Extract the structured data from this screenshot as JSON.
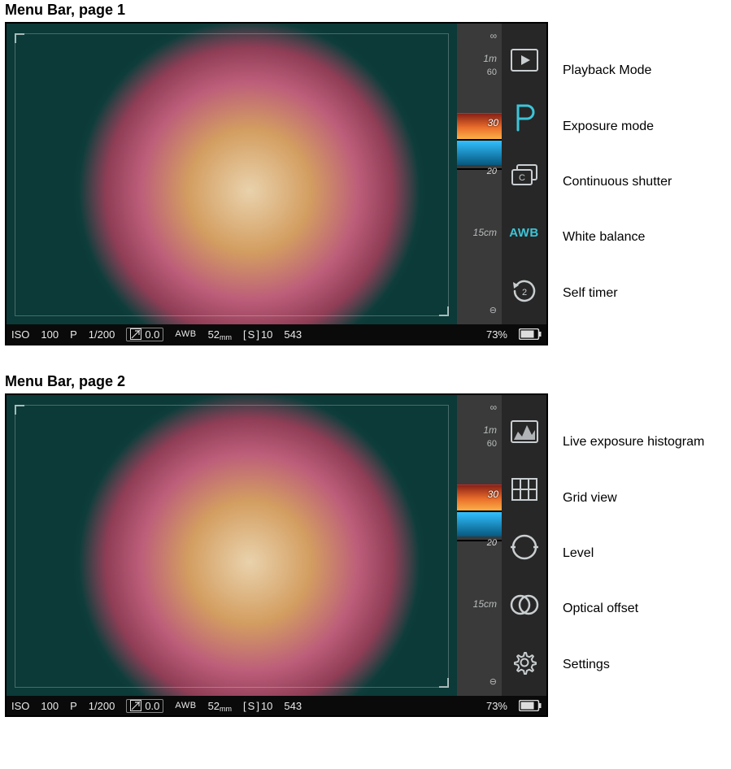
{
  "sections": [
    {
      "title": "Menu Bar, page 1"
    },
    {
      "title": "Menu Bar, page 2"
    }
  ],
  "ruler": {
    "inf": "∞",
    "d1m": "1m",
    "d60": "60",
    "d15cm": "15cm",
    "band_hi": "30",
    "band_lo": "20"
  },
  "status": {
    "iso_label": "ISO",
    "iso_value": "100",
    "mode": "P",
    "shutter": "1/200",
    "ev": "0.0",
    "awb": "AWB",
    "focal_mm": "52",
    "focal_unit": "mm",
    "bracket_s": "S",
    "bracket_n": "10",
    "shots": "543",
    "battery_pct": "73%"
  },
  "menu_p1": [
    {
      "key": "playback",
      "label": "Playback Mode"
    },
    {
      "key": "exposure",
      "label": "Exposure mode"
    },
    {
      "key": "continuous",
      "label": "Continuous shutter"
    },
    {
      "key": "awb",
      "label": "White balance",
      "glyph": "AWB"
    },
    {
      "key": "selftimer",
      "label": "Self timer"
    }
  ],
  "menu_p2": [
    {
      "key": "histogram",
      "label": "Live exposure histogram"
    },
    {
      "key": "grid",
      "label": "Grid view"
    },
    {
      "key": "level",
      "label": "Level"
    },
    {
      "key": "optical",
      "label": "Optical offset"
    },
    {
      "key": "settings",
      "label": "Settings"
    }
  ]
}
